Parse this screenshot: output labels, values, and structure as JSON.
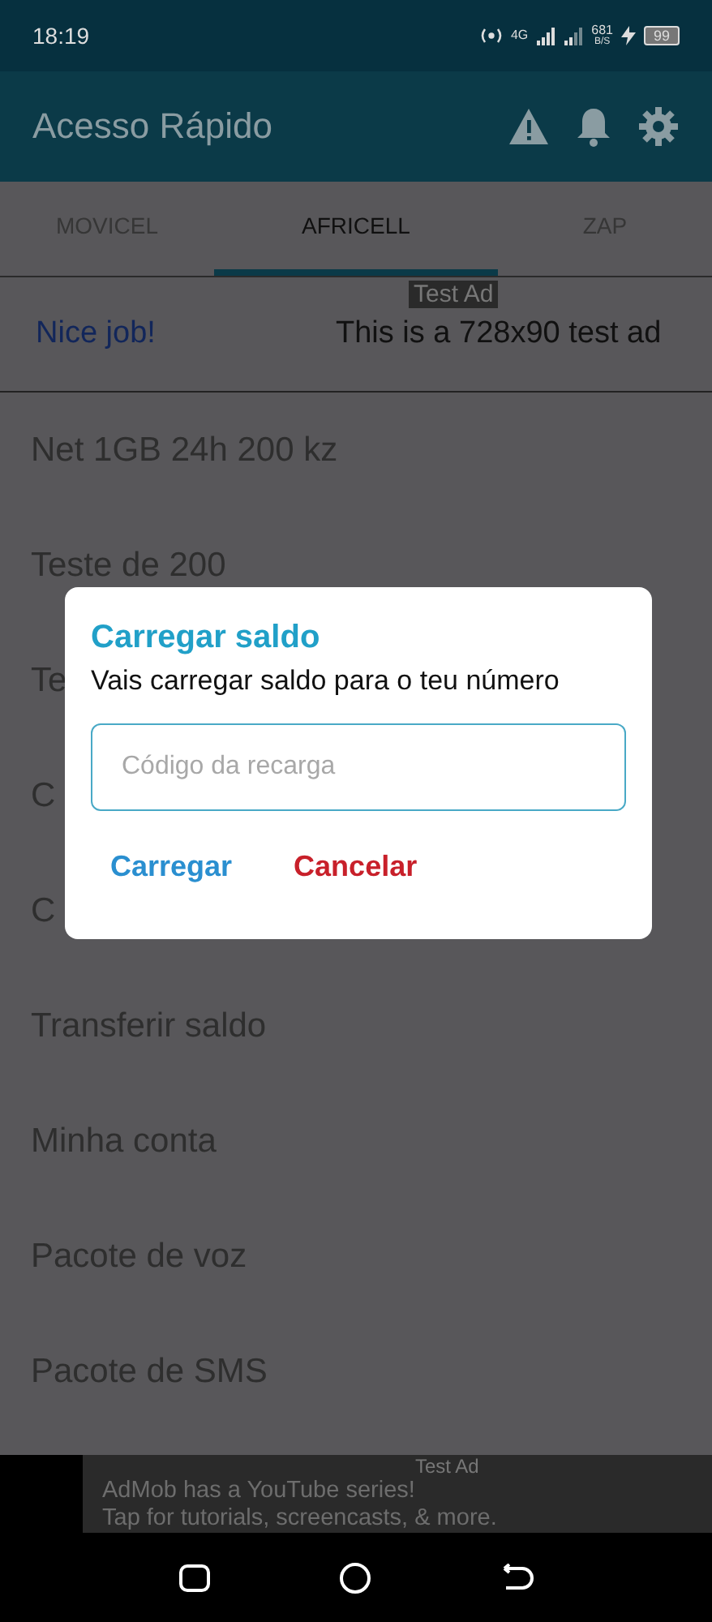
{
  "status_bar": {
    "time": "18:19",
    "network_type": "4G",
    "speed": "681",
    "speed_unit": "B/S",
    "battery": "99"
  },
  "app_bar": {
    "title": "Acesso Rápido"
  },
  "tabs": [
    {
      "label": "MOVICEL",
      "selected": false
    },
    {
      "label": "AFRICELL",
      "selected": true
    },
    {
      "label": "ZAP",
      "selected": false
    }
  ],
  "banner_ad": {
    "label": "Test Ad",
    "headline": "Nice job!",
    "text": "This is a 728x90 test ad"
  },
  "menu_items": [
    "Net 1GB 24h 200 kz",
    "Teste de 200",
    "Te",
    "C",
    "C",
    "Transferir saldo",
    "Minha conta",
    "Pacote de voz",
    "Pacote de SMS"
  ],
  "dialog": {
    "title": "Carregar saldo",
    "message": "Vais carregar saldo para o teu número",
    "input": {
      "placeholder": "Código da recarga"
    },
    "buttons": [
      {
        "label": "Carregar",
        "kind": "confirm"
      },
      {
        "label": "Cancelar",
        "kind": "cancel"
      }
    ]
  },
  "bottom_ad": {
    "label": "Test Ad",
    "lines": [
      "AdMob has a YouTube series!",
      "Tap for tutorials, screencasts, & more."
    ]
  }
}
